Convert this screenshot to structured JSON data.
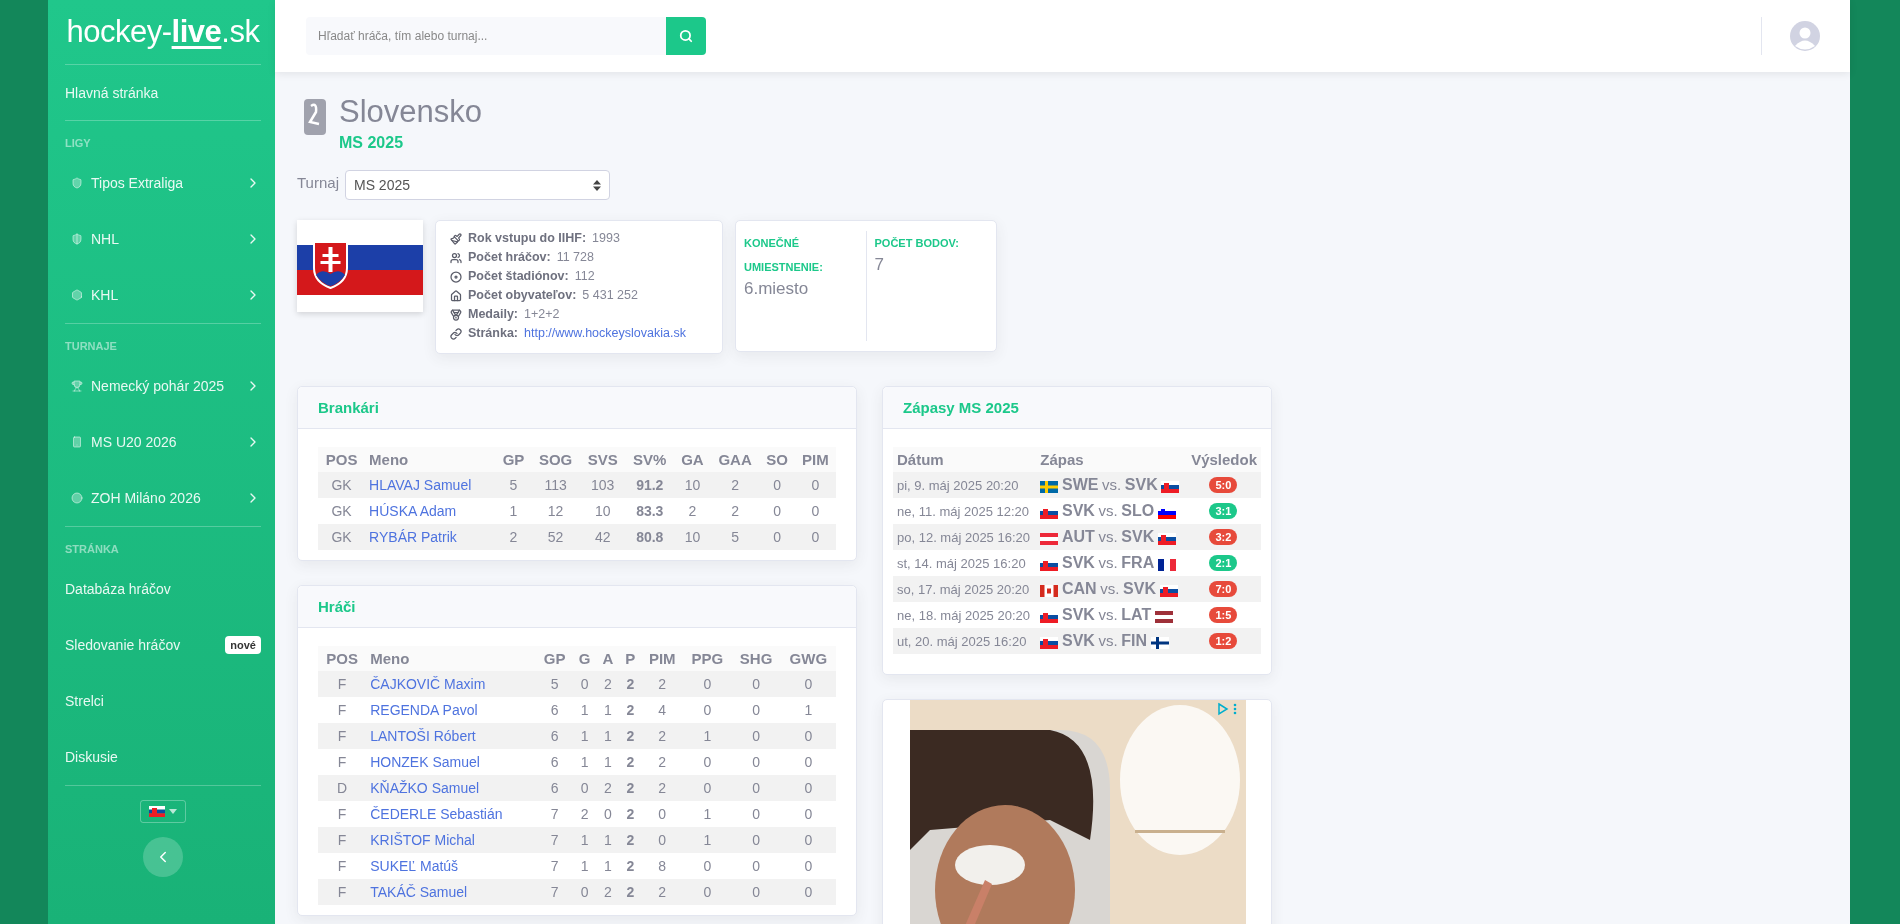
{
  "sidebar": {
    "logo": "hockey-**live**.sk",
    "home": "Hlavná stránka",
    "sections": [
      {
        "heading": "LIGY",
        "items": [
          {
            "label": "Tipos Extraliga",
            "submenu": true
          },
          {
            "label": "NHL",
            "submenu": true
          },
          {
            "label": "KHL",
            "submenu": true
          }
        ]
      },
      {
        "heading": "TURNAJE",
        "items": [
          {
            "label": "Nemecký pohár 2025",
            "submenu": true
          },
          {
            "label": "MS U20 2026",
            "submenu": true
          },
          {
            "label": "ZOH Miláno 2026",
            "submenu": true
          }
        ]
      },
      {
        "heading": "STRÁNKA",
        "items": [
          {
            "label": "Databáza hráčov",
            "submenu": false
          },
          {
            "label": "Sledovanie hráčov",
            "submenu": false,
            "badge": "nové"
          },
          {
            "label": "Strelci",
            "submenu": false
          },
          {
            "label": "Diskusie",
            "submenu": false
          }
        ]
      }
    ]
  },
  "search": {
    "placeholder": "Hľadať hráča, tím alebo turnaj..."
  },
  "team": {
    "name": "Slovensko",
    "tournament": "MS 2025",
    "select_label": "Turnaj",
    "select_value": "MS 2025",
    "info": [
      {
        "label": "Rok vstupu do IIHF:",
        "value": "1993",
        "kind": "text"
      },
      {
        "label": "Počet hráčov:",
        "value": "11 728",
        "kind": "text"
      },
      {
        "label": "Počet štadiónov:",
        "value": "112",
        "kind": "text"
      },
      {
        "label": "Počet obyvateľov:",
        "value": "5 431 252",
        "kind": "text"
      },
      {
        "label": "Medaily:",
        "value": "1+2+2",
        "kind": "text"
      },
      {
        "label": "Stránka:",
        "value": "http://www.hockeyslovakia.sk",
        "kind": "link"
      }
    ],
    "stats": [
      {
        "label": "KONEČNÉ UMIESTNENIE:",
        "value": "6.miesto"
      },
      {
        "label": "POČET BODOV:",
        "value": "7"
      }
    ]
  },
  "goalies": {
    "title": "Brankári",
    "columns": [
      "POS",
      "Meno",
      "GP",
      "SOG",
      "SVS",
      "SV%",
      "GA",
      "GAA",
      "SO",
      "PIM"
    ],
    "rows": [
      [
        "GK",
        "HLAVAJ Samuel",
        "5",
        "113",
        "103",
        "91.2",
        "10",
        "2",
        "0",
        "0"
      ],
      [
        "GK",
        "HÚSKA Adam",
        "1",
        "12",
        "10",
        "83.3",
        "2",
        "2",
        "0",
        "0"
      ],
      [
        "GK",
        "RYBÁR Patrik",
        "2",
        "52",
        "42",
        "80.8",
        "10",
        "5",
        "0",
        "0"
      ]
    ]
  },
  "players": {
    "title": "Hráči",
    "columns": [
      "POS",
      "Meno",
      "GP",
      "G",
      "A",
      "P",
      "PIM",
      "PPG",
      "SHG",
      "GWG"
    ],
    "rows": [
      [
        "F",
        "ČAJKOVIČ Maxim",
        "5",
        "0",
        "2",
        "2",
        "2",
        "0",
        "0",
        "0"
      ],
      [
        "F",
        "REGENDA Pavol",
        "6",
        "1",
        "1",
        "2",
        "4",
        "0",
        "0",
        "1"
      ],
      [
        "F",
        "LANTOŠI Róbert",
        "6",
        "1",
        "1",
        "2",
        "2",
        "1",
        "0",
        "0"
      ],
      [
        "F",
        "HONZEK Samuel",
        "6",
        "1",
        "1",
        "2",
        "2",
        "0",
        "0",
        "0"
      ],
      [
        "D",
        "KŇAŽKO Samuel",
        "6",
        "0",
        "2",
        "2",
        "2",
        "0",
        "0",
        "0"
      ],
      [
        "F",
        "ČEDERLE Sebastián",
        "7",
        "2",
        "0",
        "2",
        "0",
        "1",
        "0",
        "0"
      ],
      [
        "F",
        "KRIŠTOF Michal",
        "7",
        "1",
        "1",
        "2",
        "0",
        "1",
        "0",
        "0"
      ],
      [
        "F",
        "SUKEĽ Matúš",
        "7",
        "1",
        "1",
        "2",
        "8",
        "0",
        "0",
        "0"
      ],
      [
        "F",
        "TAKÁČ Samuel",
        "7",
        "0",
        "2",
        "2",
        "2",
        "0",
        "0",
        "0"
      ]
    ]
  },
  "matches": {
    "title": "Zápasy MS 2025",
    "columns": [
      "Dátum",
      "Zápas",
      "Výsledok"
    ],
    "rows": [
      {
        "date": "pi, 9. máj 2025 20:20",
        "home": "SWE",
        "home_flag": {
          "kind": "sweden"
        },
        "vs": "vs.",
        "away": "SVK",
        "away_flag": {
          "kind": "slovakia"
        },
        "result": "5:0",
        "won": false
      },
      {
        "date": "ne, 11. máj 2025 12:20",
        "home": "SVK",
        "home_flag": {
          "kind": "slovakia"
        },
        "vs": "vs.",
        "away": "SLO",
        "away_flag": {
          "kind": "slovenia"
        },
        "result": "3:1",
        "won": true
      },
      {
        "date": "po, 12. máj 2025 16:20",
        "home": "AUT",
        "home_flag": {
          "kind": "austria"
        },
        "vs": "vs.",
        "away": "SVK",
        "away_flag": {
          "kind": "slovakia"
        },
        "result": "3:2",
        "won": false
      },
      {
        "date": "st, 14. máj 2025 16:20",
        "home": "SVK",
        "home_flag": {
          "kind": "slovakia"
        },
        "vs": "vs.",
        "away": "FRA",
        "away_flag": {
          "kind": "france"
        },
        "result": "2:1",
        "won": true
      },
      {
        "date": "so, 17. máj 2025 20:20",
        "home": "CAN",
        "home_flag": {
          "kind": "canada"
        },
        "vs": "vs.",
        "away": "SVK",
        "away_flag": {
          "kind": "slovakia"
        },
        "result": "7:0",
        "won": false
      },
      {
        "date": "ne, 18. máj 2025 20:20",
        "home": "SVK",
        "home_flag": {
          "kind": "slovakia"
        },
        "vs": "vs.",
        "away": "LAT",
        "away_flag": {
          "kind": "latvia"
        },
        "result": "1:5",
        "won": false
      },
      {
        "date": "ut, 20. máj 2025 16:20",
        "home": "SVK",
        "home_flag": {
          "kind": "slovakia"
        },
        "vs": "vs.",
        "away": "FIN",
        "away_flag": {
          "kind": "finland"
        },
        "result": "1:2",
        "won": false
      }
    ]
  }
}
